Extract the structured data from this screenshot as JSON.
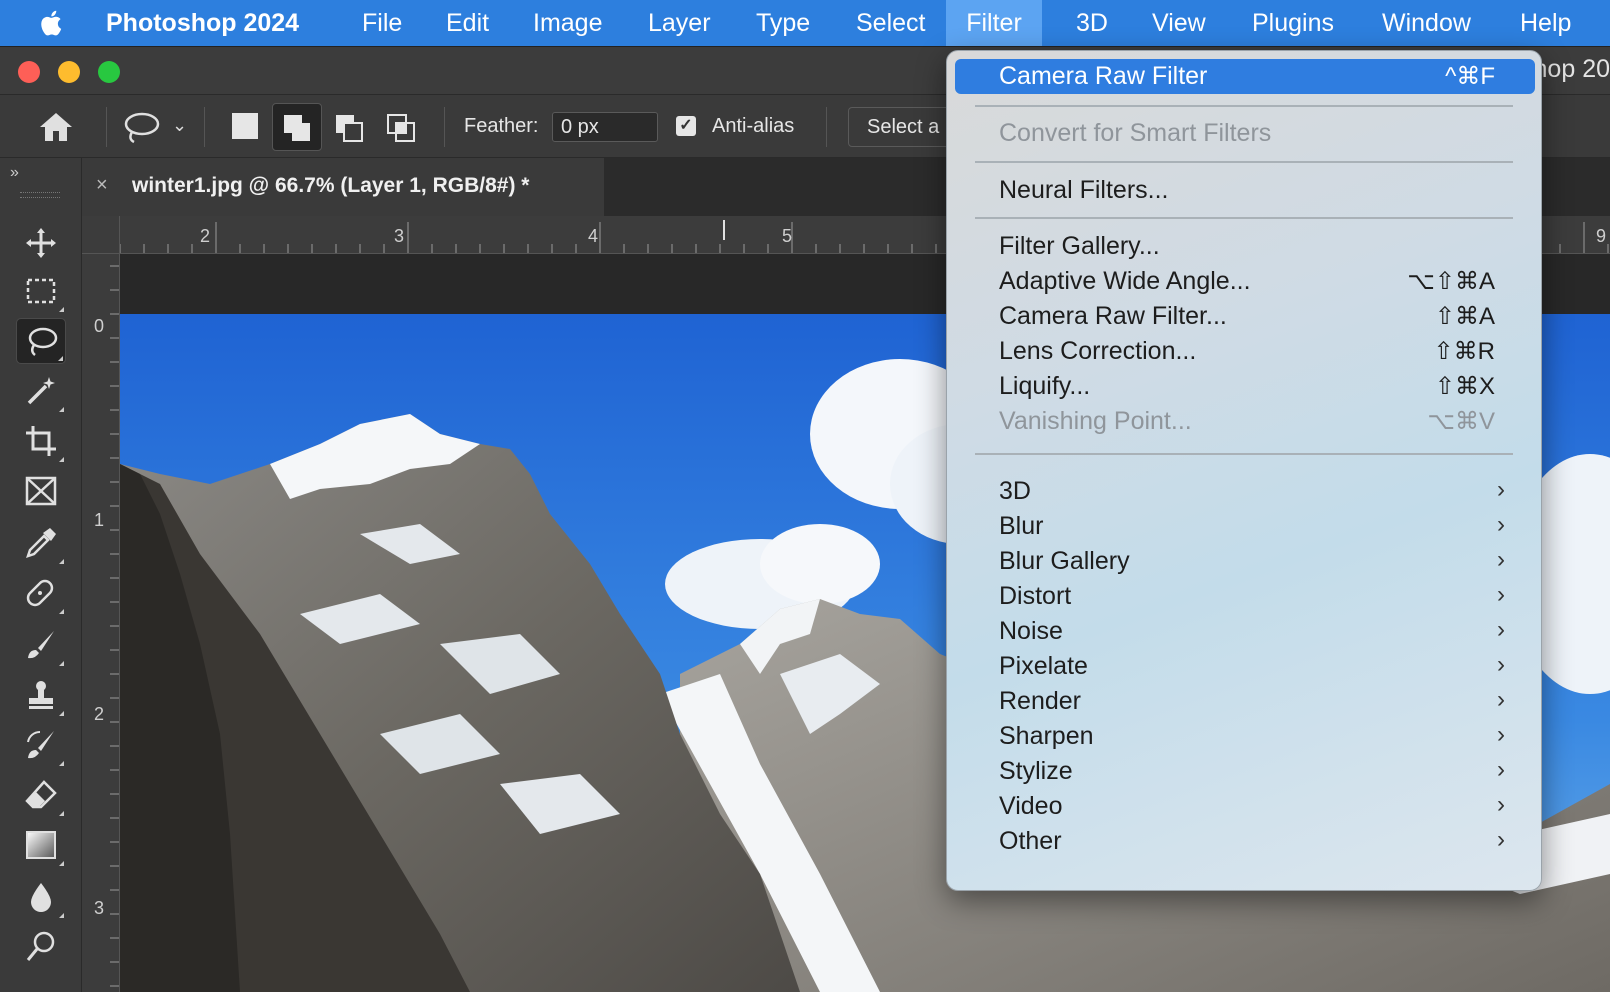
{
  "menubar": {
    "app_name": "Photoshop 2024",
    "items": [
      "File",
      "Edit",
      "Image",
      "Layer",
      "Type",
      "Select",
      "Filter",
      "3D",
      "View",
      "Plugins",
      "Window",
      "Help"
    ],
    "active": "Filter",
    "bg_color": "#2d7fde"
  },
  "window": {
    "title_fragment": "hop 20"
  },
  "options_bar": {
    "feather_label": "Feather:",
    "feather_value": "0 px",
    "antialias_label": "Anti-alias",
    "antialias_checked": true,
    "select_button": "Select a"
  },
  "toolbar": {
    "collapse_label": "»",
    "tools": [
      "move-icon",
      "marquee-icon",
      "lasso-icon",
      "magic-wand-icon",
      "crop-icon",
      "frame-icon",
      "eyedropper-icon",
      "healing-brush-icon",
      "brush-icon",
      "stamp-icon",
      "history-brush-icon",
      "eraser-icon",
      "gradient-icon",
      "blur-icon",
      "dodge-icon"
    ],
    "active_tool": "lasso-icon"
  },
  "document": {
    "tab_close": "×",
    "tab_title": "winter1.jpg @ 66.7% (Layer 1, RGB/8#) *"
  },
  "rulers": {
    "horizontal": [
      "2",
      "3",
      "4",
      "5",
      "9"
    ],
    "vertical": [
      "0",
      "1",
      "2",
      "3"
    ]
  },
  "filter_menu": {
    "top": [
      {
        "label": "Camera Raw Filter",
        "shortcut": "^⌘F",
        "highlight": true
      }
    ],
    "group1": [
      {
        "label": "Convert for Smart Filters",
        "disabled": true
      }
    ],
    "group2": [
      {
        "label": "Neural Filters..."
      }
    ],
    "group3": [
      {
        "label": "Filter Gallery..."
      },
      {
        "label": "Adaptive Wide Angle...",
        "shortcut": "⌥⇧⌘A"
      },
      {
        "label": "Camera Raw Filter...",
        "shortcut": "⇧⌘A"
      },
      {
        "label": "Lens Correction...",
        "shortcut": "⇧⌘R"
      },
      {
        "label": "Liquify...",
        "shortcut": "⇧⌘X"
      },
      {
        "label": "Vanishing Point...",
        "shortcut": "⌥⌘V",
        "disabled": true
      }
    ],
    "submenus": [
      "3D",
      "Blur",
      "Blur Gallery",
      "Distort",
      "Noise",
      "Pixelate",
      "Render",
      "Sharpen",
      "Stylize",
      "Video",
      "Other"
    ],
    "submenu_arrow": "›",
    "highlight_color": "#2f7de0"
  }
}
